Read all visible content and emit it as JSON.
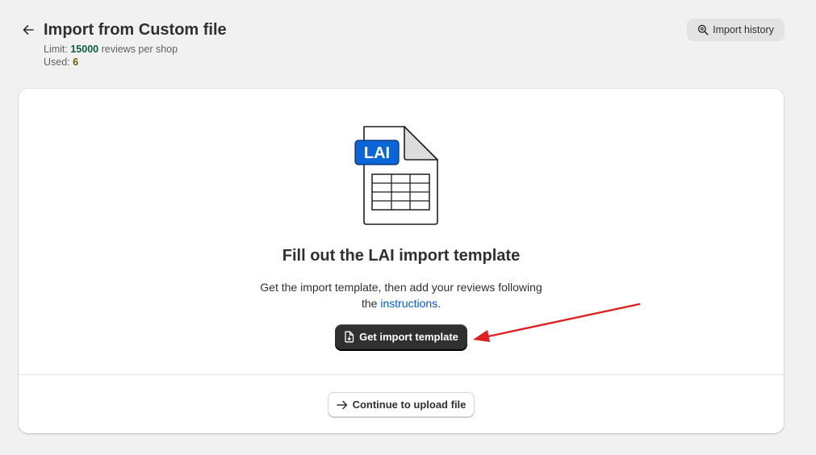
{
  "header": {
    "title": "Import from Custom file",
    "limit_label": "Limit: ",
    "limit_value": "15000",
    "limit_suffix": " reviews per shop",
    "used_label": "Used: ",
    "used_value": "6",
    "history_button": "Import history"
  },
  "card": {
    "doc_badge": "LAI",
    "heading": "Fill out the LAI import template",
    "desc_line1": "Get the import template, then add your reviews following",
    "desc_line2_prefix": "the ",
    "desc_link": "instructions",
    "desc_line2_suffix": ".",
    "template_button": "Get import template",
    "upload_button": "Continue to upload file"
  },
  "icons": {
    "back": "arrow-left-icon",
    "history": "search-icon",
    "template": "document-icon",
    "upload": "arrow-right-icon"
  },
  "colors": {
    "background": "#f1f1f1",
    "primary_button": "#303030",
    "link": "#005bd3",
    "badge": "#0a66d6",
    "limit_value": "#0b5e3c",
    "annotation_arrow": "#e02020"
  }
}
